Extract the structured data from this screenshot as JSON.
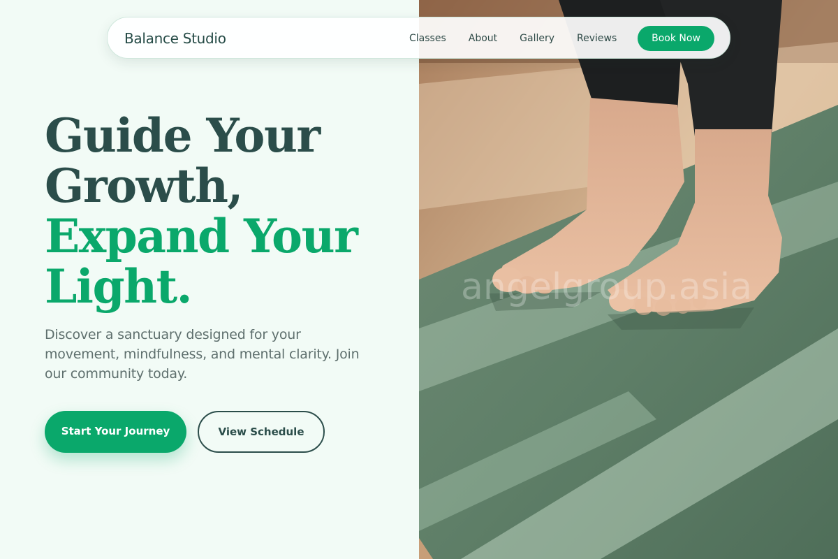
{
  "nav": {
    "brand": "Balance Studio",
    "links": [
      "Classes",
      "About",
      "Gallery",
      "Reviews"
    ],
    "cta_label": "Book Now"
  },
  "hero": {
    "headline_line1": "Guide Your",
    "headline_line2": "Growth,",
    "headline_line3": "Expand Your",
    "headline_line4": "Light.",
    "description": "Discover a sanctuary designed for your movement, mindfulness, and mental clarity. Join our community today.",
    "primary_button": "Start Your Journey",
    "secondary_button": "View Schedule"
  },
  "photo": {
    "watermark": "angelgroup.asia"
  },
  "colors": {
    "accent_green": "#0aa86b",
    "dark_teal": "#2b4d4a",
    "background": "#f2fbf6",
    "mat_green": "#5f8069"
  }
}
